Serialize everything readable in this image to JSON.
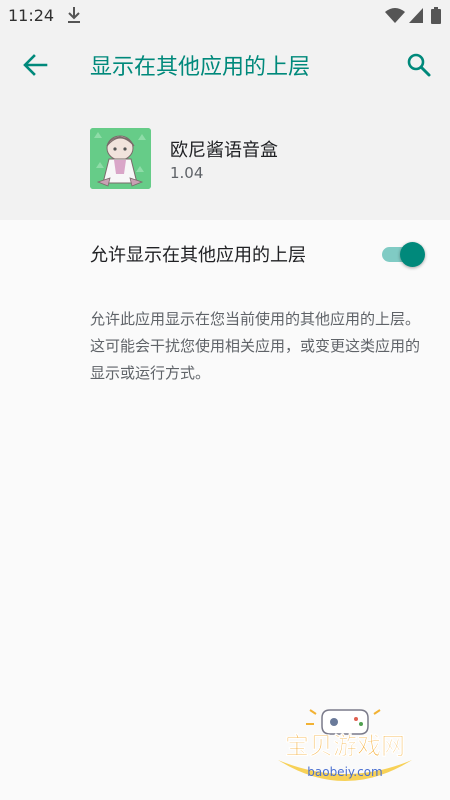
{
  "status_bar": {
    "time": "11:24",
    "icons": [
      "download-icon",
      "wifi-icon",
      "signal-icon",
      "battery-icon"
    ]
  },
  "app_bar": {
    "back_icon": "arrow-left-icon",
    "title": "显示在其他应用的上层",
    "search_icon": "search-icon"
  },
  "app_info": {
    "name": "欧尼酱语音盒",
    "version": "1.04"
  },
  "permission": {
    "label": "允许显示在其他应用的上层",
    "enabled": true
  },
  "description": "允许此应用显示在您当前使用的其他应用的上层。这可能会干扰您使用相关应用，或变更这类应用的显示或运行方式。",
  "watermark": {
    "brand": "宝贝游戏网",
    "url": "baobeiy.com"
  },
  "colors": {
    "accent": "#00897b",
    "accent_light": "#80cbc4",
    "header_bg": "#f2f2f2",
    "page_bg": "#fafafa"
  }
}
